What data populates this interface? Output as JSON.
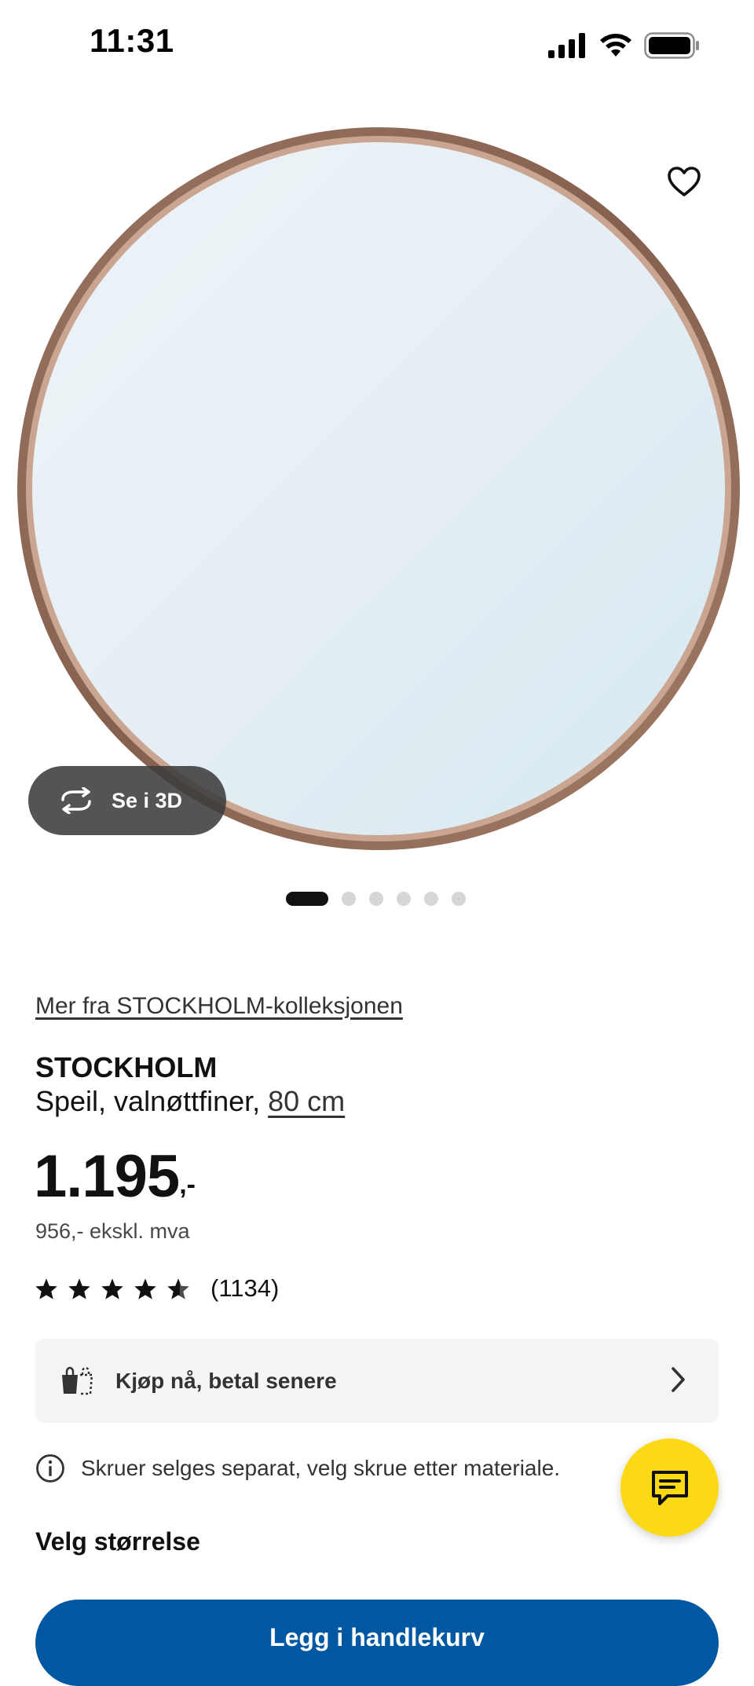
{
  "status_bar": {
    "time": "11:31",
    "icons": [
      "cellular-signal-icon",
      "wifi-icon",
      "battery-icon"
    ]
  },
  "gallery": {
    "favorite_icon": "heart-outline-icon",
    "view_3d_label": "Se i 3D",
    "view_3d_icon": "rotate-3d-icon",
    "image_count": 6,
    "active_index": 0
  },
  "product": {
    "collection_link": "Mer fra STOCKHOLM-kolleksjonen",
    "name": "STOCKHOLM",
    "description": "Speil, valnøttfiner, ",
    "size_link": "80 cm",
    "price": "1.195",
    "price_suffix": ",-",
    "price_ex_vat": "956,- ekskl. mva",
    "rating_stars": 4.5,
    "review_count": "(1134)"
  },
  "pay_later": {
    "label": "Kjøp nå, betal senere",
    "icon": "pay-later-icon"
  },
  "info": {
    "text": "Skruer selges separat, velg skrue etter materiale.",
    "icon": "info-icon"
  },
  "size_selector": {
    "heading": "Velg størrelse"
  },
  "cart": {
    "label": "Legg i handlekurv"
  },
  "chat": {
    "icon": "chat-icon"
  },
  "colors": {
    "brand_blue": "#0058a3",
    "brand_yellow": "#fbd914",
    "mirror_frame": "#8a6555"
  }
}
